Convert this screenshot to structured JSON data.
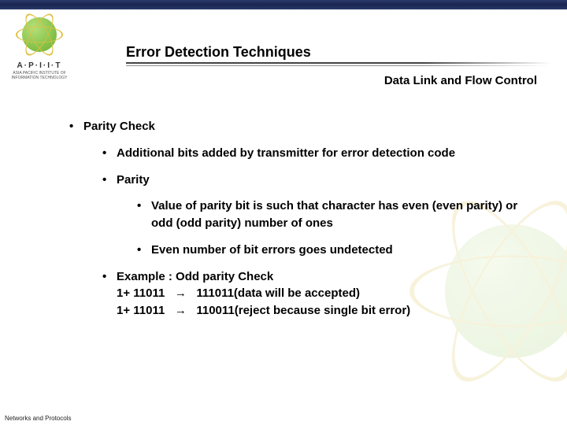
{
  "logo": {
    "name": "A·P·I·I·T",
    "sub": "ASIA PACIFIC INSTITUTE OF INFORMATION TECHNOLOGY"
  },
  "title": "Error Detection Techniques",
  "subtitle": "Data Link and Flow Control",
  "content": {
    "h1": "Parity Check",
    "b1": "Additional bits added by transmitter for error detection code",
    "b2": "Parity",
    "b2a": "Value of parity bit is such that character has even (even parity) or odd (odd parity) number of ones",
    "b2b": "Even number of bit errors goes undetected",
    "b3_lead": "Example : Odd parity Check",
    "b3_l1a": "1+ 11011",
    "b3_l1b": "111011(data will be accepted)",
    "b3_l2a": "1+ 11011",
    "b3_l2b": "110011(reject because single bit error)",
    "arrow": "→"
  },
  "footer": "Networks and Protocols"
}
